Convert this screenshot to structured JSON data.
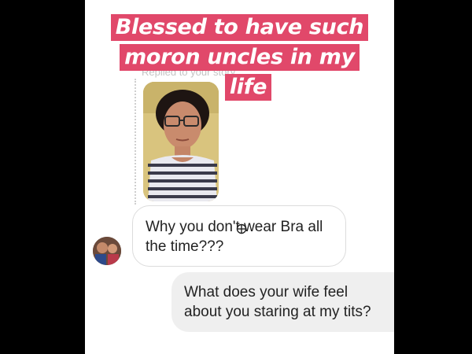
{
  "story_reply": {
    "caption": "Replied to your story"
  },
  "headline": {
    "lines": [
      "Blessed to have such",
      "moron uncles in my",
      "life"
    ],
    "background_color": "#e1486a",
    "text_color": "#ffffff"
  },
  "thread": {
    "incoming_message": "Why you don't wear Bra all the time???",
    "outgoing_message": "What does your wife feel about you staring at my tits?"
  },
  "icons": {
    "cursor": "crosshair-cursor-icon"
  }
}
